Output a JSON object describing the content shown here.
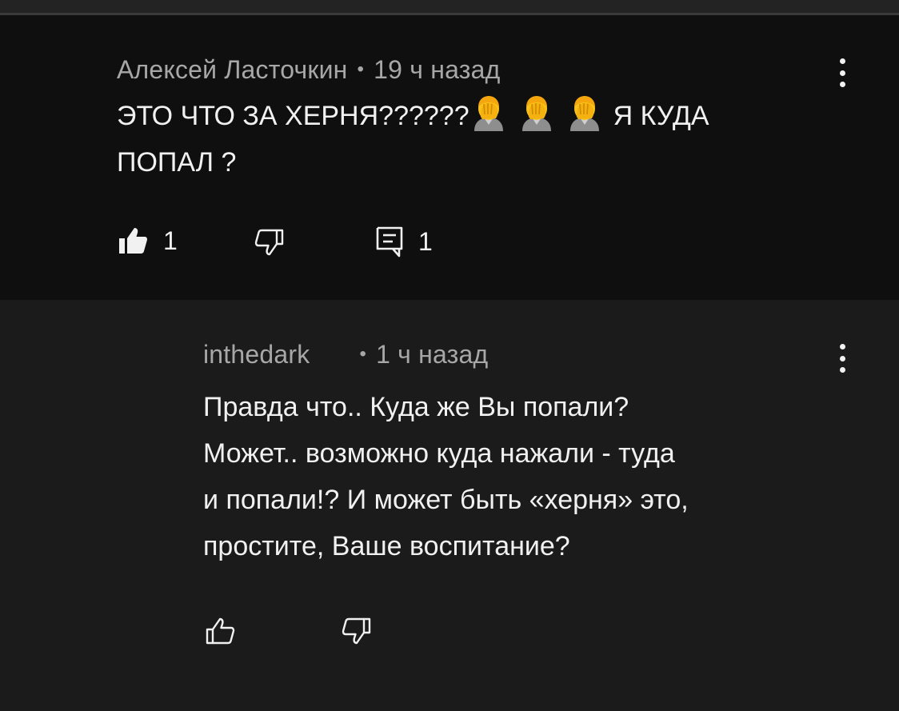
{
  "comment": {
    "author": "Алексей Ласточкин",
    "separator": "•",
    "time": "19 ч назад",
    "text_part1": "ЭТО ЧТО ЗА ХЕРНЯ??????",
    "emoji": "face-palm-emoji",
    "text_part2": "Я КУДА",
    "text_line2": "ПОПАЛ ?",
    "like_count": "1",
    "reply_count": "1",
    "like_icon": "thumbs-up-filled-icon",
    "dislike_icon": "thumbs-down-outline-icon",
    "reply_icon": "comment-icon",
    "menu_icon": "more-vertical-icon"
  },
  "reply": {
    "author": "inthedark",
    "separator": "•",
    "time": "1 ч назад",
    "lines": [
      "Правда что.. Куда же Вы попали?",
      "Может.. возможно куда нажали - туда",
      "и попали!? И может быть «херня» это,",
      "простите, Ваше воспитание?"
    ],
    "like_icon": "thumbs-up-outline-icon",
    "dislike_icon": "thumbs-down-outline-icon",
    "menu_icon": "more-vertical-icon"
  },
  "colors": {
    "background_main": "#0f0f0f",
    "background_reply": "#1b1b1b",
    "text_primary": "#f1f1f1",
    "text_secondary": "#a7a7a7"
  }
}
